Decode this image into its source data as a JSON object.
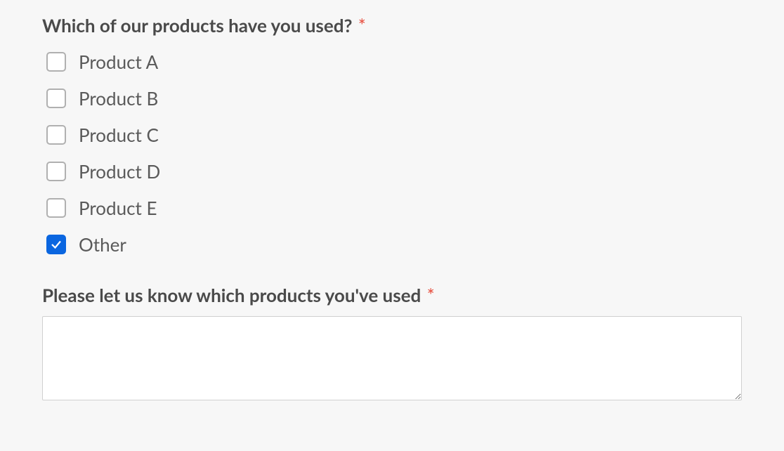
{
  "question": {
    "title": "Which of our products have you used?",
    "required_marker": "*",
    "options": [
      {
        "label": "Product A",
        "checked": false
      },
      {
        "label": "Product B",
        "checked": false
      },
      {
        "label": "Product C",
        "checked": false
      },
      {
        "label": "Product D",
        "checked": false
      },
      {
        "label": "Product E",
        "checked": false
      },
      {
        "label": "Other",
        "checked": true
      }
    ]
  },
  "followup": {
    "title": "Please let us know which products you've used",
    "required_marker": "*",
    "value": ""
  }
}
